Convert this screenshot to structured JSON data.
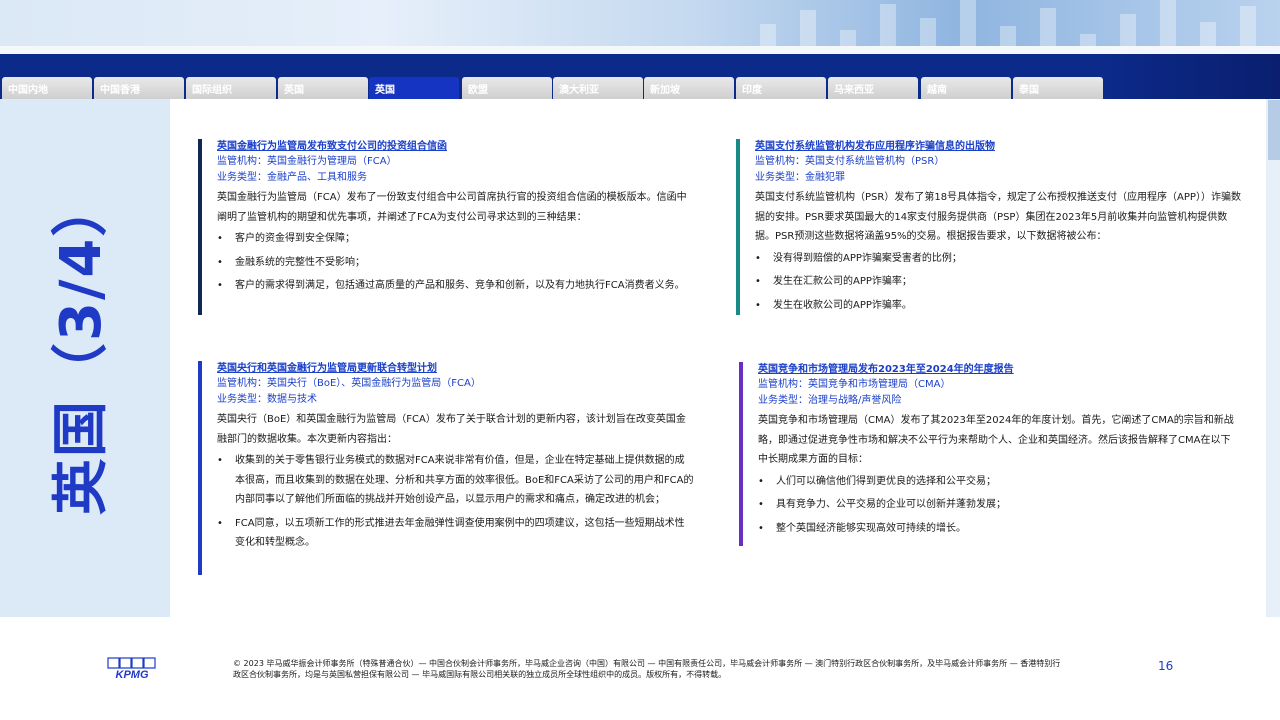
{
  "tabs": [
    "中国内地",
    "中国香港",
    "国际组织",
    "英国",
    "英国",
    "欧盟",
    "澳大利亚",
    "新加坡",
    "印度",
    "马来西亚",
    "越南",
    "泰国"
  ],
  "active_tab_index": 4,
  "vertical_title": "英国（3/4）",
  "cards": [
    {
      "title": "英国金融行为监管局发布致支付公司的投资组合信函",
      "regulator": "监管机构：英国金融行为管理局（FCA）",
      "business": "业务类型：金融产品、工具和服务",
      "body": "英国金融行为监管局（FCA）发布了一份致支付组合中公司首席执行官的投资组合信函的模板版本。信函中阐明了监管机构的期望和优先事项，并阐述了FCA为支付公司寻求达到的三种结果：",
      "bullets": [
        "客户的资金得到安全保障；",
        "金融系统的完整性不受影响；",
        "客户的需求得到满足，包括通过高质量的产品和服务、竞争和创新，以及有力地执行FCA消费者义务。"
      ],
      "color": "#0e2a52"
    },
    {
      "title": "英国支付系统监管机构发布应用程序诈骗信息的出版物",
      "regulator": "监管机构：英国支付系统监管机构（PSR）",
      "business": "业务类型：金融犯罪",
      "body": "英国支付系统监管机构（PSR）发布了第18号具体指令，规定了公布授权推送支付（应用程序（APP））诈骗数据的安排。PSR要求英国最大的14家支付服务提供商（PSP）集团在2023年5月前收集并向监管机构提供数据。PSR预测这些数据将涵盖95%的交易。根据报告要求，以下数据将被公布：",
      "bullets": [
        "没有得到赔偿的APP诈骗案受害者的比例；",
        "发生在汇款公司的APP诈骗率；",
        "发生在收款公司的APP诈骗率。"
      ],
      "color": "#1a8a86"
    },
    {
      "title": "英国央行和英国金融行为监管局更新联合转型计划",
      "regulator": "监管机构：英国央行（BoE）、英国金融行为监管局（FCA）",
      "business": "业务类型：数据与技术",
      "body": "英国央行（BoE）和英国金融行为监管局（FCA）发布了关于联合计划的更新内容，该计划旨在改变英国金融部门的数据收集。本次更新内容指出：",
      "bullets": [
        "收集到的关于零售银行业务模式的数据对FCA来说非常有价值，但是，企业在特定基础上提供数据的成本很高，而且收集到的数据在处理、分析和共享方面的效率很低。BoE和FCA采访了公司的用户和FCA的内部同事以了解他们所面临的挑战并开始创设产品，以显示用户的需求和痛点，确定改进的机会；",
        "FCA同意，以五项新工作的形式推进去年金融弹性调查使用案例中的四项建议，这包括一些短期战术性变化和转型概念。"
      ],
      "color": "#1f3bc6"
    },
    {
      "title": "英国竞争和市场管理局发布2023年至2024年的年度报告",
      "regulator": "监管机构：英国竞争和市场管理局（CMA）",
      "business": "业务类型：治理与战略/声誉风险",
      "body": "英国竞争和市场管理局（CMA）发布了其2023年至2024年的年度计划。首先，它阐述了CMA的宗旨和新战略，即通过促进竞争性市场和解决不公平行为来帮助个人、企业和英国经济。然后该报告解释了CMA在以下中长期成果方面的目标：",
      "bullets": [
        "人们可以确信他们得到更优良的选择和公平交易；",
        "具有竞争力、公平交易的企业可以创新并蓬勃发展；",
        "整个英国经济能够实现高效可持续的增长。"
      ],
      "color": "#6a2ec4"
    }
  ],
  "footer": {
    "logo": "KPMG",
    "copyright": "© 2023 毕马威华振会计师事务所（特殊普通合伙）— 中国合伙制会计师事务所，毕马威企业咨询（中国）有限公司 — 中国有限责任公司，毕马威会计师事务所 — 澳门特别行政区合伙制事务所，及毕马威会计师事务所 — 香港特别行政区合伙制事务所，均是与英国私营担保有限公司 — 毕马威国际有限公司相关联的独立成员所全球性组织中的成员。版权所有，不得转载。",
    "page_number": "16"
  },
  "colors": {
    "brand": "#1f3bc6",
    "navy": "#0c2a8a"
  }
}
